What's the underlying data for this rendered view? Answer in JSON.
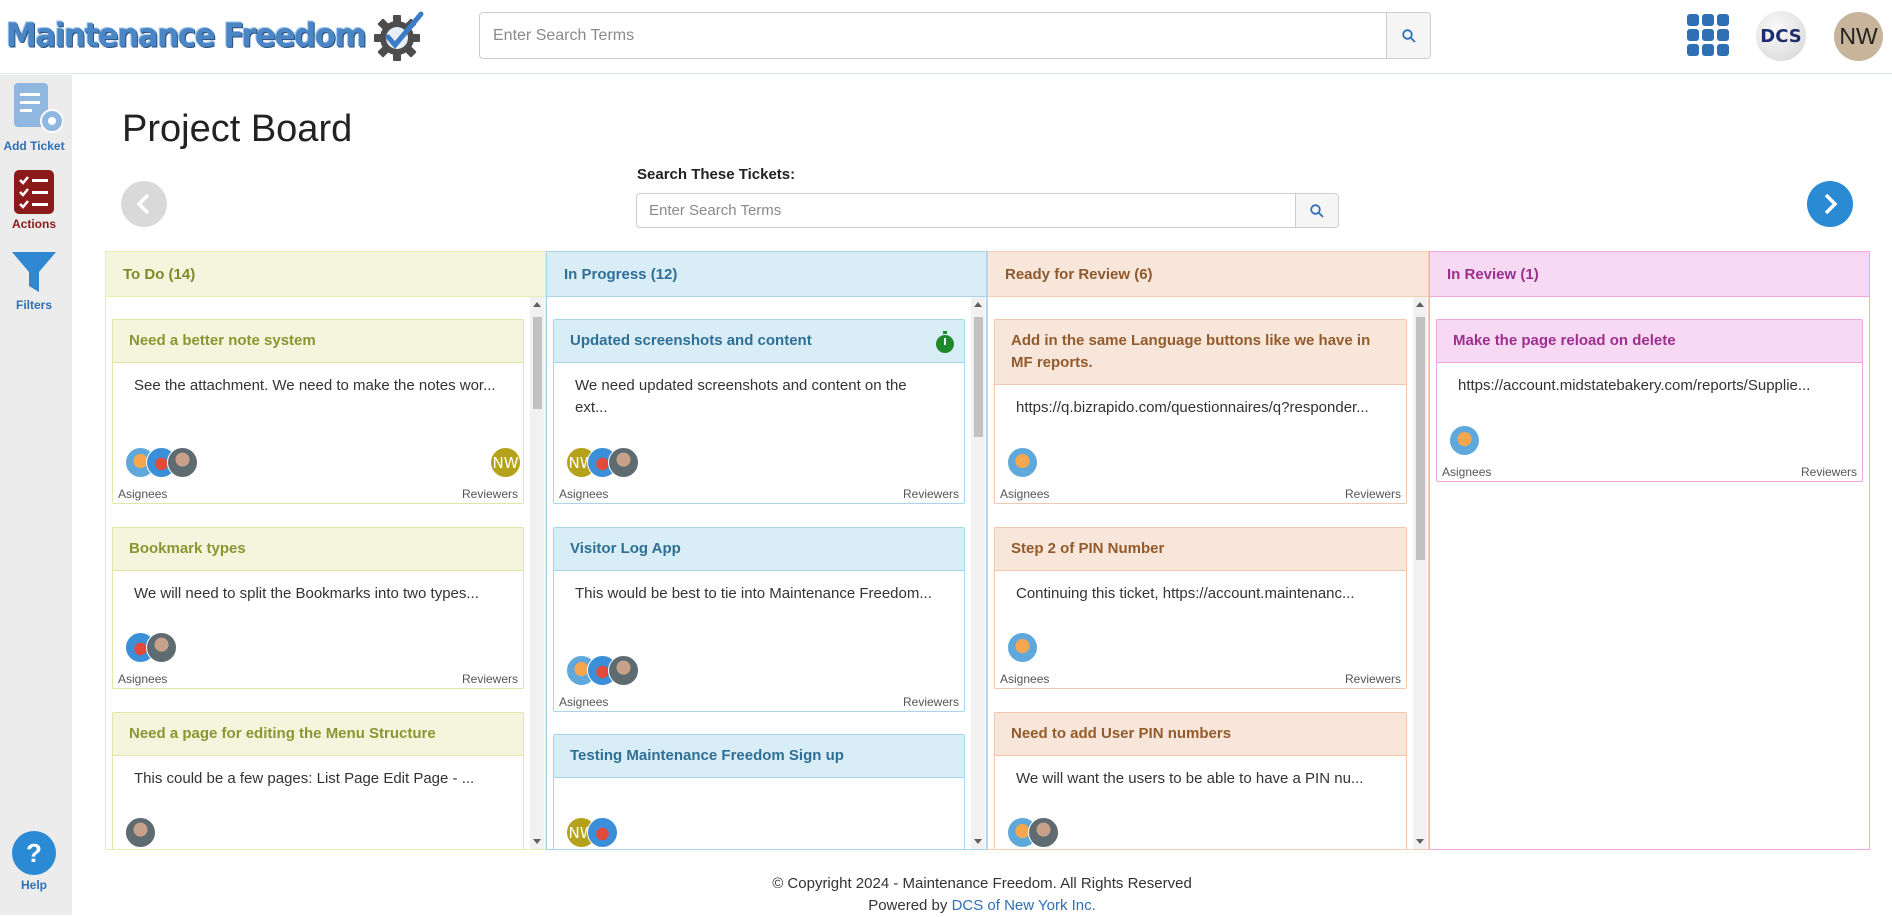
{
  "app": {
    "logo_text": "Maintenance Freedom",
    "search_placeholder": "Enter Search Terms",
    "dcs_label": "DCS",
    "user_initials": "NW"
  },
  "sidebar": {
    "items": [
      {
        "label": "Add Ticket",
        "icon": "add-ticket-icon"
      },
      {
        "label": "Actions",
        "icon": "actions-checklist-icon"
      },
      {
        "label": "Filters",
        "icon": "filter-funnel-icon"
      }
    ],
    "help": {
      "label": "Help",
      "icon": "help-icon"
    }
  },
  "page": {
    "title": "Project Board",
    "ticket_search_label": "Search These Tickets:",
    "ticket_search_placeholder": "Enter Search Terms"
  },
  "columns": [
    {
      "title": "To Do (14)",
      "cards": [
        {
          "title": "Need a better note system",
          "desc": "See the attachment. We need to make the notes wor...",
          "assignees_label": "Asignees",
          "reviewers_label": "Reviewers",
          "reviewer": "NW"
        },
        {
          "title": "Bookmark types",
          "desc": "We will need to split the Bookmarks into two types...",
          "assignees_label": "Asignees",
          "reviewers_label": "Reviewers"
        },
        {
          "title": "Need a page for editing the Menu Structure",
          "desc": "This could be a few pages: List Page Edit Page - ..."
        }
      ]
    },
    {
      "title": "In Progress (12)",
      "cards": [
        {
          "title": "Updated screenshots and content",
          "desc": "We need updated screenshots and content on the ext...",
          "assignees_label": "Asignees",
          "reviewers_label": "Reviewers",
          "assignee_initials": "NW"
        },
        {
          "title": "Visitor Log App",
          "desc": "This would be best to tie into Maintenance Freedom...",
          "assignees_label": "Asignees",
          "reviewers_label": "Reviewers"
        },
        {
          "title": "Testing Maintenance Freedom Sign up",
          "desc": "",
          "assignee_initials": "NW"
        }
      ]
    },
    {
      "title": "Ready for Review (6)",
      "cards": [
        {
          "title": "Add in the same Language buttons like we have in MF reports.",
          "desc": "https://q.bizrapido.com/questionnaires/q?responder...",
          "assignees_label": "Asignees",
          "reviewers_label": "Reviewers"
        },
        {
          "title": "Step 2 of PIN Number",
          "desc": "Continuing this ticket, https://account.maintenanc...",
          "assignees_label": "Asignees",
          "reviewers_label": "Reviewers"
        },
        {
          "title": "Need to add User PIN numbers",
          "desc": "We will want the users to be able to have a PIN nu..."
        }
      ]
    },
    {
      "title": "In Review (1)",
      "cards": [
        {
          "title": "Make the page reload on delete",
          "desc": "https://account.midstatebakery.com/reports/Supplie...",
          "assignees_label": "Asignees",
          "reviewers_label": "Reviewers"
        }
      ]
    }
  ],
  "footer": {
    "copyright": "© Copyright 2024 - Maintenance Freedom. All Rights Reserved",
    "powered_by": "Powered by",
    "powered_link": "DCS of New York Inc."
  },
  "colors": {
    "brand_blue": "#2f6fb3",
    "actions_red": "#8b1a1a",
    "todo": "#f3f6dc",
    "in_progress": "#d9edf6",
    "ready_for_review": "#f8e6da",
    "in_review": "#f8d9f4"
  }
}
